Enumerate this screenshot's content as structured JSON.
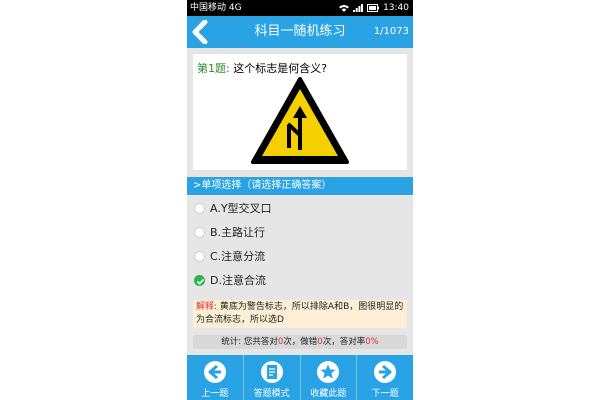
{
  "status": {
    "carrier": "中国移动 4G",
    "time": "13:40"
  },
  "header": {
    "title": "科目一随机练习",
    "counter": "1/1073"
  },
  "question": {
    "number_label": "第1题:",
    "text": "这个标志是何含义?"
  },
  "type_bar": ">单项选择（请选择正确答案）",
  "options": [
    {
      "label": "A.Y型交叉口",
      "checked": false
    },
    {
      "label": "B.主路让行",
      "checked": false
    },
    {
      "label": "C.注意分流",
      "checked": false
    },
    {
      "label": "D.注意合流",
      "checked": true
    }
  ],
  "explanation": {
    "label": "解释:",
    "text": "黄底为警告标志，所以排除A和B，图很明显的为合流标志，所以选D"
  },
  "stats": {
    "prefix": "统计: 您共答对",
    "correct": "0",
    "mid1": "次，做错",
    "wrong": "0",
    "mid2": "次，答对率",
    "rate": "0%"
  },
  "toolbar": [
    {
      "label": "上一题",
      "icon": "arrow-left-icon"
    },
    {
      "label": "答题模式",
      "icon": "document-icon"
    },
    {
      "label": "收藏此题",
      "icon": "star-icon"
    },
    {
      "label": "下一题",
      "icon": "arrow-right-icon"
    }
  ],
  "colors": {
    "accent": "#29a3e4",
    "check": "#2fb34a",
    "highlight": "#e03131",
    "sign_yellow": "#f5d000"
  }
}
